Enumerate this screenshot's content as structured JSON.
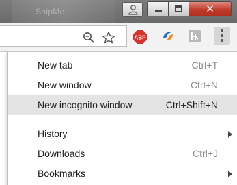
{
  "titlebar": {
    "tab_ghost_text": "SnipMe"
  },
  "toolbar": {
    "icons": [
      "zoom-icon",
      "star-icon",
      "adblock-plus-icon",
      "extension-icon",
      "extension-icon",
      "chrome-menu-icon"
    ],
    "abp_label": "ABP"
  },
  "menu": {
    "items": [
      {
        "label": "New tab",
        "shortcut": "Ctrl+T"
      },
      {
        "label": "New window",
        "shortcut": "Ctrl+N"
      },
      {
        "label": "New incognito window",
        "shortcut": "Ctrl+Shift+N",
        "highlighted": true
      },
      {
        "label": "History",
        "shortcut": "",
        "submenu": true
      },
      {
        "label": "Downloads",
        "shortcut": "Ctrl+J"
      },
      {
        "label": "Bookmarks",
        "shortcut": "",
        "submenu": true
      }
    ]
  },
  "colors": {
    "titlebar": "#707070",
    "close_button": "#c13a2b",
    "menu_highlight": "#e4e4e4",
    "abp_red": "#d9322b"
  }
}
